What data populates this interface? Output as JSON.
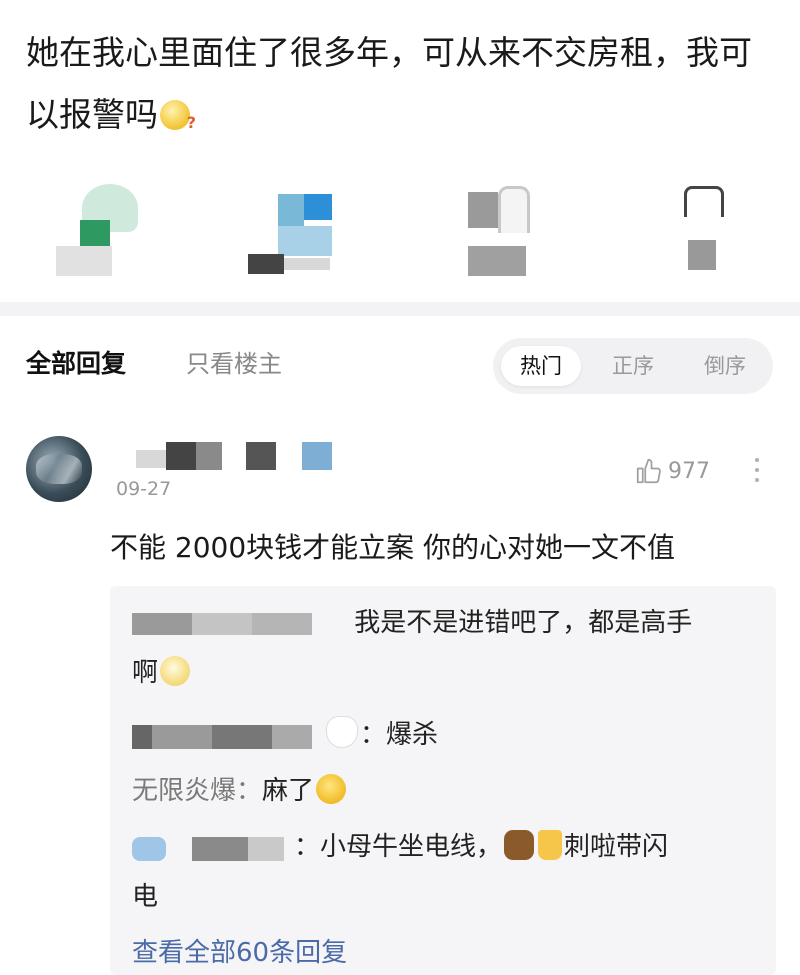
{
  "post": {
    "text": "她在我心里面住了很多年，可从来不交房租，我可以报警吗"
  },
  "colors": {
    "link_blue": "#4a6aa8",
    "reply_bg": "#f5f5f7",
    "muted": "#999999"
  },
  "tabs": {
    "all_replies": "全部回复",
    "op_only": "只看楼主"
  },
  "sort": {
    "hot": "热门",
    "asc": "正序",
    "desc": "倒序",
    "selected": "热门"
  },
  "comment": {
    "date": "09-27",
    "likes": "977",
    "text": "不能 2000块钱才能立案 你的心对她一文不值"
  },
  "replies": [
    {
      "text": "我是不是进错吧了，都是高手",
      "text_cont": "啊"
    },
    {
      "text": "：爆杀"
    },
    {
      "author": "无限炎爆：",
      "text": "麻了"
    },
    {
      "text": "：小母牛坐电线，",
      "text2": "刺啦带闪",
      "text_cont": "电"
    }
  ],
  "view_all": "查看全部60条回复",
  "icons": {
    "thumb_up": "thumb-up-icon",
    "more": "more-vertical-icon"
  }
}
